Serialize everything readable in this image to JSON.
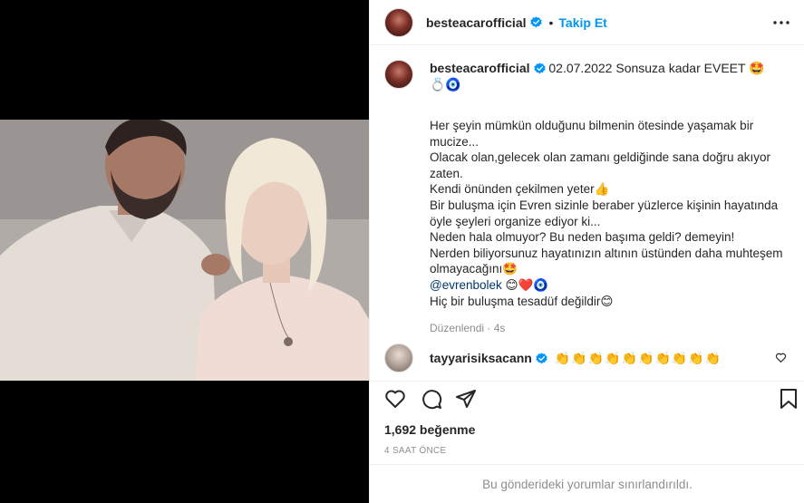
{
  "post": {
    "username": "besteacarofficial",
    "follow_label": "Takip Et",
    "separator": "•",
    "caption_date": "02.07.2022",
    "caption_title": "Sonsuza kadar EVEET 🤩",
    "caption_emojis": "💍🧿",
    "body_lines": [
      "Her şeyin mümkün olduğunu bilmenin ötesinde yaşamak bir mucize...",
      "Olacak olan,gelecek olan zamanı geldiğinde sana doğru akıyor zaten.",
      "Kendi önünden çekilmen yeter👍",
      "Bir buluşma için Evren sizinle beraber yüzlerce kişinin hayatında öyle şeyleri organize ediyor ki...",
      "Neden hala olmuyor? Bu neden başıma geldi? demeyin!",
      "Nerden biliyorsunuz hayatınızın altının üstünden daha muhteşem olmayacağını🤩"
    ],
    "mention": "@evrenbolek",
    "mention_emojis": "😊❤️🧿",
    "last_line": "Hiç bir buluşma tesadüf değildir😊",
    "edited_label": "Düzenlendi · 4s"
  },
  "comment": {
    "username": "tayyarisiksacann",
    "text": "👏👏👏👏👏👏👏👏👏👏"
  },
  "stats": {
    "likes": "1,692 beğenme",
    "time_ago": "4 SAAT ÖNCE"
  },
  "footer": {
    "comments_limited": "Bu gönderideki yorumlar sınırlandırıldı."
  },
  "icons": {
    "verified": "verified-badge-icon",
    "more": "more-options-icon",
    "like": "heart-icon",
    "comment": "comment-icon",
    "share": "share-icon",
    "save": "bookmark-icon"
  },
  "colors": {
    "accent": "#0095f6",
    "verified": "#0095f6",
    "muted": "#8e8e8e",
    "mention": "#00376b"
  }
}
